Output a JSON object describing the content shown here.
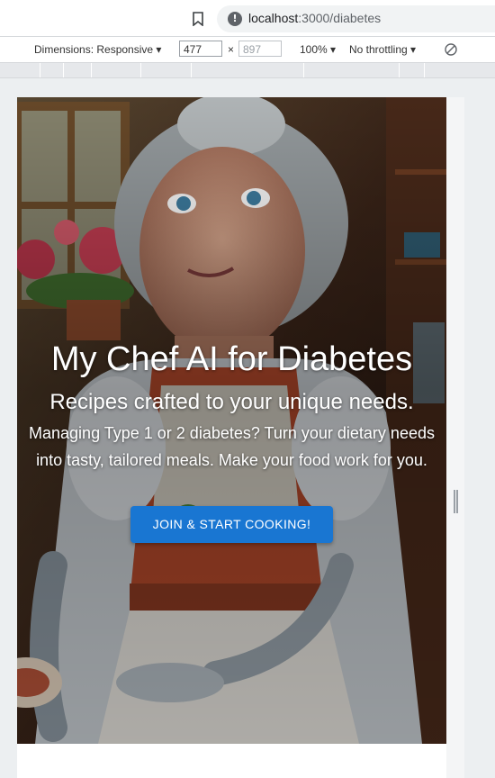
{
  "browser": {
    "url_host": "localhost",
    "url_port_path": ":3000/diabetes"
  },
  "device_toolbar": {
    "dimensions_label": "Dimensions: Responsive",
    "width_value": "477",
    "times": "×",
    "height_placeholder": "897",
    "zoom": "100%",
    "throttling": "No throttling"
  },
  "hero": {
    "title": "My Chef AI for Diabetes",
    "subtitle": "Recipes crafted to your unique needs.",
    "body": "Managing Type 1 or 2 diabetes? Turn your dietary needs into tasty, tailored meals. Make your food work for you.",
    "cta_label": "JOIN & START COOKING!",
    "cta_color": "#1976d2"
  }
}
